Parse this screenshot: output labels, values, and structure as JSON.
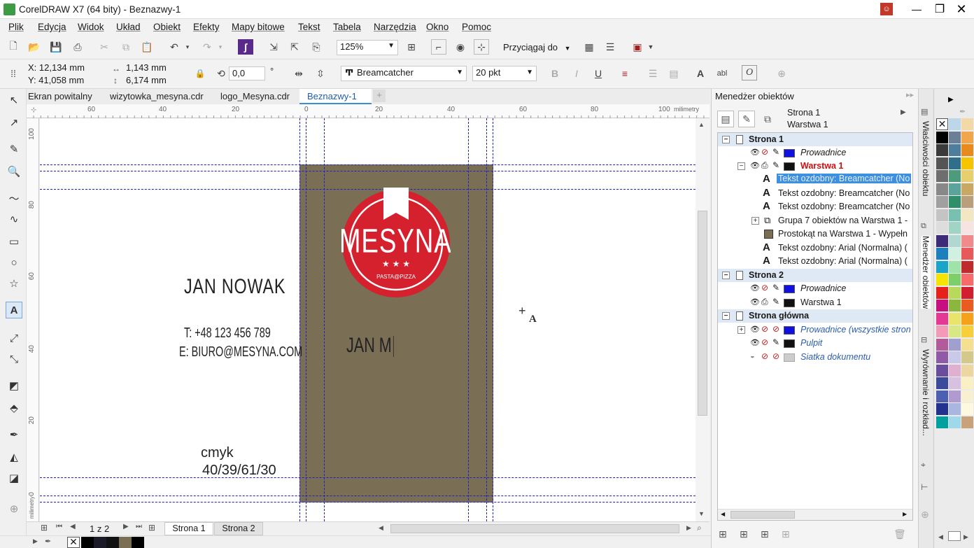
{
  "window": {
    "title": "CorelDRAW X7 (64 bity) - Beznazwy-1"
  },
  "menu": [
    "Plik",
    "Edycja",
    "Widok",
    "Układ",
    "Obiekt",
    "Efekty",
    "Mapy bitowe",
    "Tekst",
    "Tabela",
    "Narzędzia",
    "Okno",
    "Pomoc"
  ],
  "toolbar": {
    "zoom": "125%",
    "snap_label": "Przyciągaj do"
  },
  "properties": {
    "x": "X: 12,134 mm",
    "y": "Y: 41,058 mm",
    "w": "1,143 mm",
    "h": "6,174 mm",
    "angle": "0,0",
    "angle_unit": "°",
    "font": "Breamcatcher",
    "size": "20 pkt"
  },
  "tabs": [
    "Ekran powitalny",
    "wizytowka_mesyna.cdr",
    "logo_Mesyna.cdr",
    "Beznazwy-1"
  ],
  "ruler": {
    "unit": "milimetry",
    "h_ticks": [
      "60",
      "40",
      "20",
      "0",
      "20",
      "40",
      "60",
      "80",
      "100"
    ],
    "v_ticks": [
      "100",
      "80",
      "60",
      "40",
      "20",
      "0"
    ],
    "v_unit": "milimetry"
  },
  "card": {
    "name": "JAN NOWAK",
    "phone": "T: +48 123 456 789",
    "email": "E: BIURO@MESYNA.COM",
    "cmyk_label": "cmyk",
    "cmyk_value": "40/39/61/30",
    "logo_text": "MESYNA",
    "logo_stars": "★ ★ ★",
    "logo_sub": "PASTA@PIZZA",
    "typing_text": "JAN M",
    "bg_color": "#7a6e55",
    "logo_color": "#d5202e"
  },
  "pagenav": {
    "counter": "1 z 2",
    "pages": [
      "Strona 1",
      "Strona 2"
    ]
  },
  "object_manager": {
    "title": "Menedżer obiektów",
    "current_page": "Strona 1",
    "current_layer": "Warstwa 1",
    "tree": [
      {
        "label": "Strona 1",
        "type": "page"
      },
      {
        "label": "Prowadnice",
        "type": "guides",
        "color": "#1010e0"
      },
      {
        "label": "Warstwa 1",
        "type": "layer-active",
        "color": "#111111"
      },
      {
        "label": "Tekst ozdobny: Breamcatcher (No",
        "type": "text-selected"
      },
      {
        "label": "Tekst ozdobny: Breamcatcher (No",
        "type": "text"
      },
      {
        "label": "Tekst ozdobny: Breamcatcher (No",
        "type": "text"
      },
      {
        "label": "Grupa 7 obiektów na Warstwa 1 -",
        "type": "group"
      },
      {
        "label": "Prostokąt na Warstwa 1 - Wypełn",
        "type": "rect"
      },
      {
        "label": "Tekst ozdobny: Arial (Normalna) (",
        "type": "text"
      },
      {
        "label": "Tekst ozdobny: Arial (Normalna) (",
        "type": "text"
      },
      {
        "label": "Strona 2",
        "type": "page"
      },
      {
        "label": "Prowadnice",
        "type": "guides",
        "color": "#1010e0"
      },
      {
        "label": "Warstwa 1",
        "type": "layer",
        "color": "#111111"
      },
      {
        "label": "Strona główna",
        "type": "page"
      },
      {
        "label": "Prowadnice (wszystkie stron",
        "type": "master",
        "color": "#1010e0"
      },
      {
        "label": "Pulpit",
        "type": "master",
        "color": "#111111"
      },
      {
        "label": "Siatka dokumentu",
        "type": "master",
        "color": "#cccccc"
      }
    ]
  },
  "side_tabs": [
    "Właściwości obiektu",
    "Menedżer obiektów",
    "Wyrównanie i rozkład..."
  ],
  "palette": [
    "#ffffff",
    "#bcd7ea",
    "#f3d9a6",
    "#000000",
    "#6b7f96",
    "#f1a64b",
    "#3a3a3a",
    "#4d7e9e",
    "#e88a1c",
    "#555555",
    "#2f6f8c",
    "#f6c500",
    "#6e6e6e",
    "#4e9a7d",
    "#e8cf6e",
    "#888888",
    "#5ba39b",
    "#c8a862",
    "#a0a0a0",
    "#2f8f6a",
    "#b9a07a",
    "#c4c4c4",
    "#7ac0b0",
    "#f3e7c2",
    "#dddddd",
    "#a0d4c4",
    "#f8e3e3",
    "#3d2a78",
    "#b0d8d0",
    "#f18a8a",
    "#1e7fbf",
    "#d0f0e0",
    "#e85a5a",
    "#1aa4c8",
    "#9fe3a8",
    "#c02b2b",
    "#f5e300",
    "#7dcf6a",
    "#f76b6b",
    "#e6211c",
    "#b8d95a",
    "#d21e2e",
    "#c70f7e",
    "#8ab73c",
    "#e95b1f",
    "#e53895",
    "#e9e56a",
    "#f6a11b",
    "#f29ab7",
    "#d8e885",
    "#f7cf3a",
    "#b35a9b",
    "#a0a0d0",
    "#f4e08e",
    "#8f5aa6",
    "#c9c9e9",
    "#d4c98a",
    "#6b4e9b",
    "#e0b0d0",
    "#ecd7a0",
    "#3b4a9b",
    "#d8c0e0",
    "#fbefc4",
    "#4c5fb0",
    "#b09ad0",
    "#f8f0d0",
    "#24328f",
    "#a8b6e0",
    "#fff8e0",
    "#00a0a0",
    "#9fd8e8",
    "#c9a27a"
  ]
}
